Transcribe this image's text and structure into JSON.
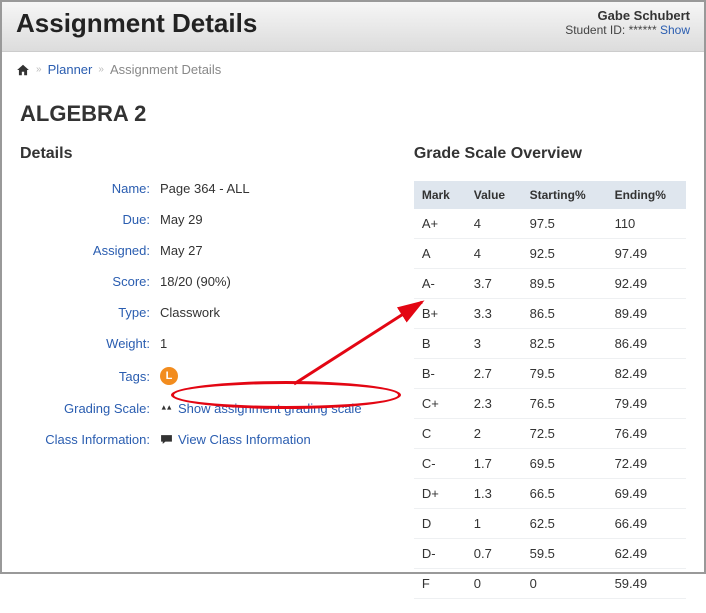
{
  "header": {
    "title": "Assignment Details",
    "user_name": "Gabe Schubert",
    "sid_label": "Student ID:",
    "sid_masked": "******",
    "show_link": "Show"
  },
  "breadcrumb": {
    "planner": "Planner",
    "current": "Assignment Details"
  },
  "class_title": "ALGEBRA 2",
  "details": {
    "section_title": "Details",
    "labels": {
      "name": "Name:",
      "due": "Due:",
      "assigned": "Assigned:",
      "score": "Score:",
      "type": "Type:",
      "weight": "Weight:",
      "tags": "Tags:",
      "grading_scale": "Grading Scale:",
      "class_info": "Class Information:"
    },
    "values": {
      "name": "Page 364 - ALL",
      "due": "May 29",
      "assigned": "May 27",
      "score": "18/20 (90%)",
      "type": "Classwork",
      "weight": "1",
      "tag_badge": "L",
      "show_scale_link": "Show assignment grading scale",
      "view_class_link": "View Class Information"
    }
  },
  "grade_scale": {
    "section_title": "Grade Scale Overview",
    "headers": {
      "mark": "Mark",
      "value": "Value",
      "start": "Starting%",
      "end": "Ending%"
    },
    "rows": [
      {
        "mark": "A+",
        "value": "4",
        "start": "97.5",
        "end": "110"
      },
      {
        "mark": "A",
        "value": "4",
        "start": "92.5",
        "end": "97.49"
      },
      {
        "mark": "A-",
        "value": "3.7",
        "start": "89.5",
        "end": "92.49"
      },
      {
        "mark": "B+",
        "value": "3.3",
        "start": "86.5",
        "end": "89.49"
      },
      {
        "mark": "B",
        "value": "3",
        "start": "82.5",
        "end": "86.49"
      },
      {
        "mark": "B-",
        "value": "2.7",
        "start": "79.5",
        "end": "82.49"
      },
      {
        "mark": "C+",
        "value": "2.3",
        "start": "76.5",
        "end": "79.49"
      },
      {
        "mark": "C",
        "value": "2",
        "start": "72.5",
        "end": "76.49"
      },
      {
        "mark": "C-",
        "value": "1.7",
        "start": "69.5",
        "end": "72.49"
      },
      {
        "mark": "D+",
        "value": "1.3",
        "start": "66.5",
        "end": "69.49"
      },
      {
        "mark": "D",
        "value": "1",
        "start": "62.5",
        "end": "66.49"
      },
      {
        "mark": "D-",
        "value": "0.7",
        "start": "59.5",
        "end": "62.49"
      },
      {
        "mark": "F",
        "value": "0",
        "start": "0",
        "end": "59.49"
      }
    ]
  }
}
